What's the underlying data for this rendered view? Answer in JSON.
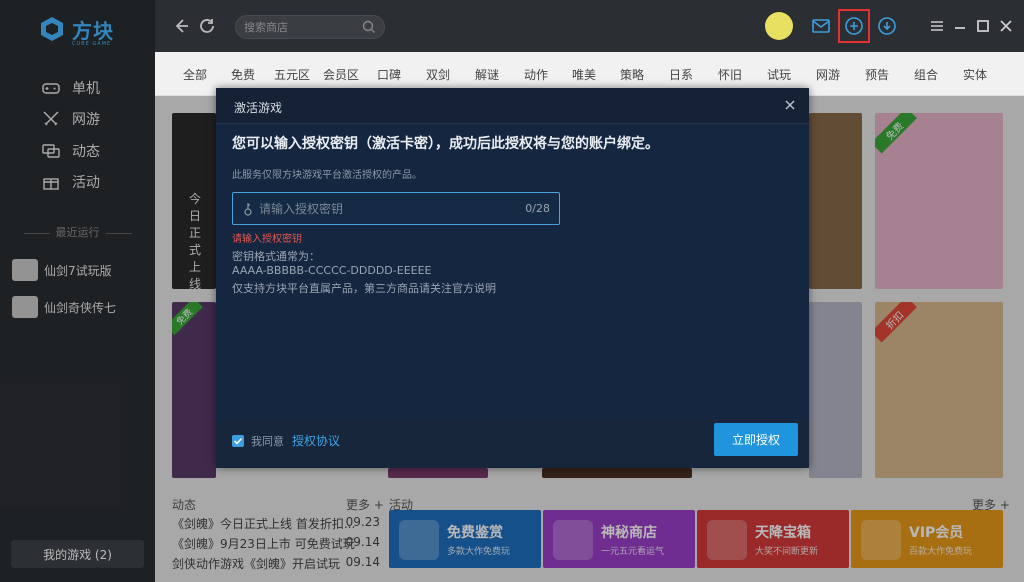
{
  "app": {
    "brand": "方块",
    "brand_sub": "CUBE GAME"
  },
  "sidebar": {
    "nav": [
      {
        "label": "单机",
        "icon": "gamepad-icon"
      },
      {
        "label": "网游",
        "icon": "swords-icon"
      },
      {
        "label": "动态",
        "icon": "chat-icon"
      },
      {
        "label": "活动",
        "icon": "gift-icon"
      }
    ],
    "recent_label": "最近运行",
    "recent": [
      "仙剑7试玩版",
      "仙剑奇侠传七"
    ],
    "my_games": "我的游戏 (2)"
  },
  "topbar": {
    "search_placeholder": "搜索商店"
  },
  "categories": [
    "全部",
    "免费",
    "五元区",
    "会员区",
    "口碑",
    "双剑",
    "解谜",
    "动作",
    "唯美",
    "策略",
    "日系",
    "怀旧",
    "试玩",
    "网游",
    "预告",
    "组合",
    "实体"
  ],
  "content": {
    "news_header": "动态",
    "activity_header": "活动",
    "more": "更多 +",
    "news": [
      {
        "text": "《剑魄》今日正式上线 首发折扣...",
        "date": "09.23"
      },
      {
        "text": "《剑魄》9月23日上市 可免费试玩",
        "date": "09.14"
      },
      {
        "text": "剑侠动作游戏《剑魄》开启试玩",
        "date": "09.14"
      }
    ],
    "activities": [
      {
        "title": "免费鉴赏",
        "sub": "多款大作免费玩",
        "color": "#1f6fc0"
      },
      {
        "title": "神秘商店",
        "sub": "一元五元看运气",
        "color": "#9a3ec9"
      },
      {
        "title": "天降宝箱",
        "sub": "大奖不间断更新",
        "color": "#d63b3b"
      },
      {
        "title": "VIP会员",
        "sub": "百款大作免费玩",
        "color": "#e89a1a"
      }
    ],
    "card_texts": {
      "free_badge": "免费",
      "discount_badge": "折扣",
      "poster_vertical": "今日正式上线"
    }
  },
  "modal": {
    "title": "激活游戏",
    "heading": "您可以输入授权密钥（激活卡密），成功后此授权将与您的账户绑定。",
    "subtext": "此服务仅限方块游戏平台激活授权的产品。",
    "input_placeholder": "请输入授权密钥",
    "counter": "0/28",
    "error": "请输入授权密钥",
    "format_lines": [
      "密钥格式通常为：",
      "AAAA-BBBBB-CCCCC-DDDDD-EEEEE",
      "仅支持方块平台直属产品，第三方商品请关注官方说明"
    ],
    "agree_text": "我同意",
    "agree_link": "授权协议",
    "submit": "立即授权"
  }
}
